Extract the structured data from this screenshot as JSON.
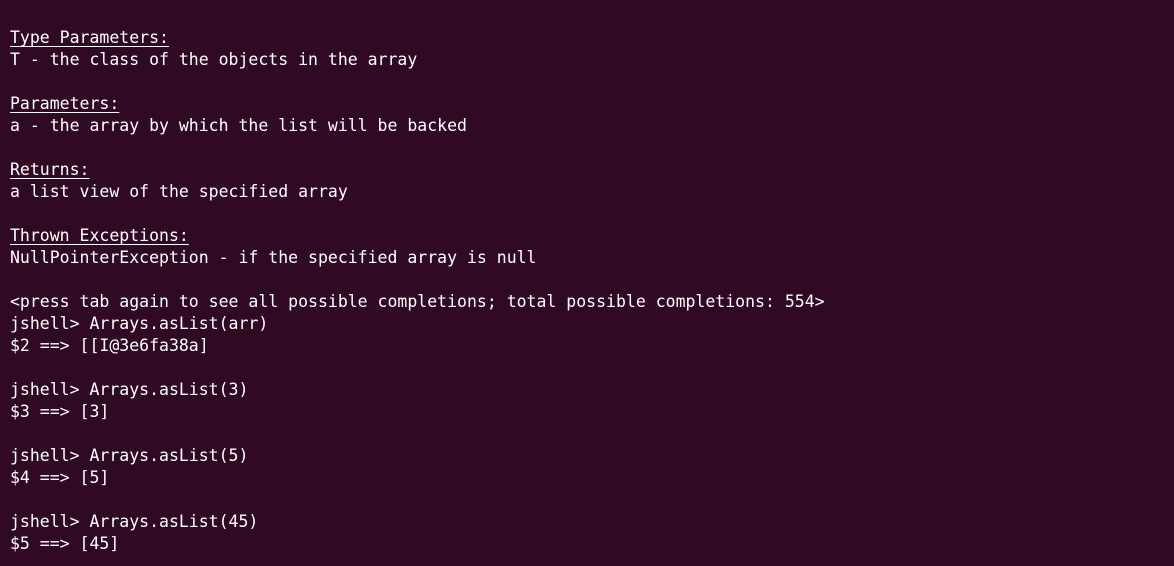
{
  "terminal": {
    "lines": [
      {
        "kind": "text",
        "text": "                                                        "
      },
      {
        "kind": "blank",
        "text": ""
      },
      {
        "kind": "heading",
        "text": "Type Parameters:"
      },
      {
        "kind": "text",
        "text": "T - the class of the objects in the array"
      },
      {
        "kind": "blank",
        "text": ""
      },
      {
        "kind": "heading",
        "text": "Parameters:"
      },
      {
        "kind": "text",
        "text": "a - the array by which the list will be backed"
      },
      {
        "kind": "blank",
        "text": ""
      },
      {
        "kind": "heading",
        "text": "Returns:"
      },
      {
        "kind": "text",
        "text": "a list view of the specified array"
      },
      {
        "kind": "blank",
        "text": ""
      },
      {
        "kind": "heading",
        "text": "Thrown Exceptions:"
      },
      {
        "kind": "text",
        "text": "NullPointerException - if the specified array is null"
      },
      {
        "kind": "blank",
        "text": ""
      },
      {
        "kind": "text",
        "text": "<press tab again to see all possible completions; total possible completions: 554>"
      },
      {
        "kind": "prompt",
        "text": "jshell> Arrays.asList(arr)"
      },
      {
        "kind": "output",
        "text": "$2 ==> [[I@3e6fa38a]"
      },
      {
        "kind": "blank",
        "text": ""
      },
      {
        "kind": "prompt",
        "text": "jshell> Arrays.asList(3)"
      },
      {
        "kind": "output",
        "text": "$3 ==> [3]"
      },
      {
        "kind": "blank",
        "text": ""
      },
      {
        "kind": "prompt",
        "text": "jshell> Arrays.asList(5)"
      },
      {
        "kind": "output",
        "text": "$4 ==> [5]"
      },
      {
        "kind": "blank",
        "text": ""
      },
      {
        "kind": "prompt",
        "text": "jshell> Arrays.asList(45)"
      },
      {
        "kind": "output",
        "text": "$5 ==> [45]"
      }
    ]
  },
  "colors": {
    "background": "#300a24",
    "foreground": "#ffffff"
  }
}
